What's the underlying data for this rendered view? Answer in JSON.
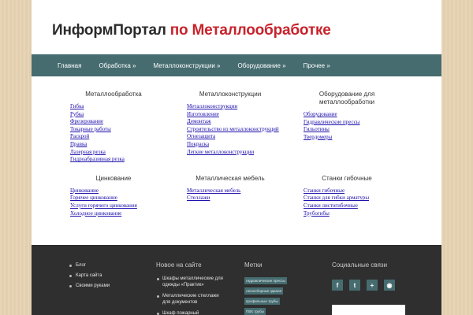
{
  "site": {
    "title": "ИнформПортал",
    "title_accent": "по Металлообработке"
  },
  "nav": [
    "Главная",
    "Обработка »",
    "Металлоконструкции »",
    "Оборудование »",
    "Прочее »"
  ],
  "menu": [
    {
      "title": "Металлообработка",
      "links": [
        "Гибка",
        "Рубка",
        "Фрезерование",
        "Токарные работы",
        "Раскрой",
        "Правка",
        "Лазерная резка",
        "Гидроабразивная резка"
      ]
    },
    {
      "title": "Металлоконструкции",
      "links": [
        "Металлоконструкции",
        "Изготовление",
        "Демонтаж",
        "Строительство из металлоконструкций",
        "Огнезащита",
        "Покраска",
        "Легкие металлоконструкции"
      ]
    },
    {
      "title": "Оборудование для металлообработки",
      "links": [
        "Оборудование",
        "Гидравлические прессы",
        "Гильотины",
        "Твердомеры"
      ]
    },
    {
      "title": "Цинкование",
      "links": [
        "Цинкование",
        "Горячее цинкование",
        "Услуги горячего цинкования",
        "Холодное цинкование"
      ]
    },
    {
      "title": "Металлическая мебель",
      "links": [
        "Металлическая мебель",
        "Стеллажи"
      ]
    },
    {
      "title": "Станки гибочные",
      "links": [
        "Станки гибочные",
        "Станки для гибки арматуры",
        "Станки листогибочные",
        "Трубогибы"
      ]
    }
  ],
  "footer": {
    "links": [
      "Блог",
      "Карта сайта",
      "Своими руками"
    ],
    "new_title": "Новое на сайте",
    "new_items": [
      "Шкафы металлические для одежды «Практик»",
      "Металлические стеллажи для документов",
      "Шкаф пожарный металлический"
    ],
    "tags_title": "Метки",
    "tags": [
      "гидравлические прессы",
      "легкосборные здания",
      "профильные трубы",
      "ПВХ трубы"
    ],
    "social_title": "Социальные связи",
    "social": [
      {
        "icon": "facebook-icon",
        "glyph": "f"
      },
      {
        "icon": "twitter-icon",
        "glyph": "t"
      },
      {
        "icon": "google-plus-icon",
        "glyph": "+"
      },
      {
        "icon": "rss-icon",
        "glyph": "◉"
      }
    ]
  }
}
